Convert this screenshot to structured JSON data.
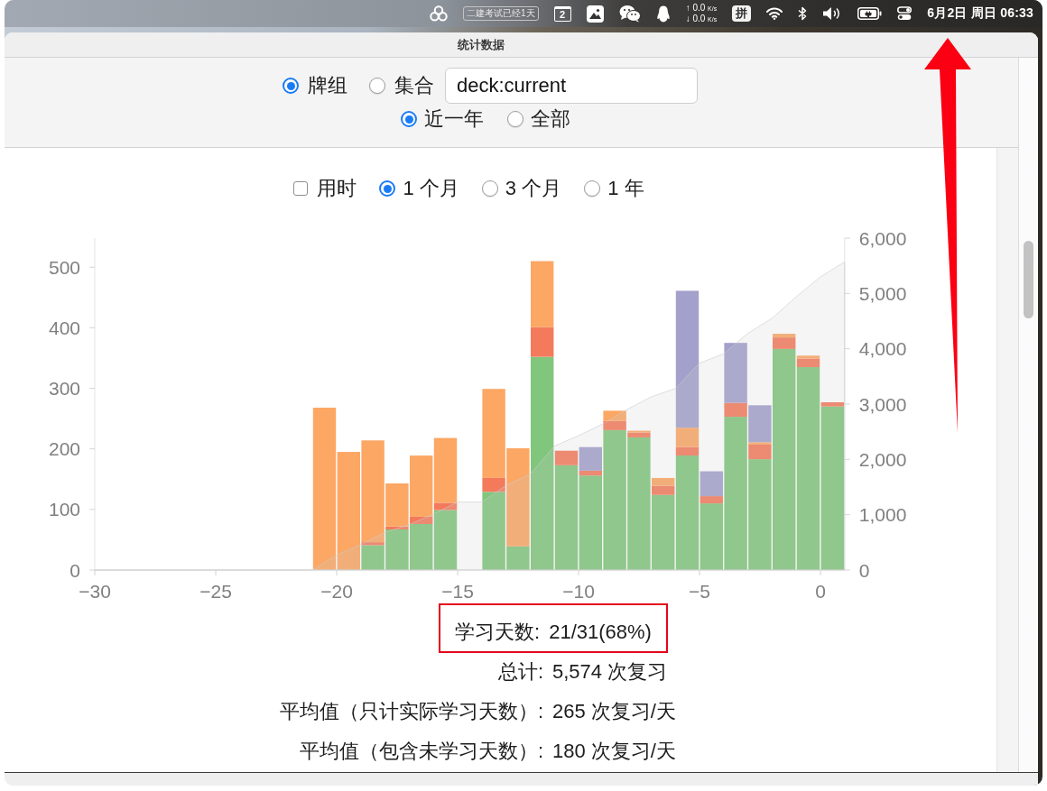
{
  "menu_bar": {
    "badge": "二建考试已经1天",
    "calendar_day": "2",
    "net_speed": [
      {
        "arrow": "↑",
        "value": "0.0",
        "unit": "K/s"
      },
      {
        "arrow": "↓",
        "value": "0.0",
        "unit": "K/s"
      }
    ],
    "input_method": "拼",
    "clock": "6月2日 周日 06:33"
  },
  "window": {
    "title": "统计数据"
  },
  "search_scope": [
    {
      "label": "牌组",
      "selected": true
    },
    {
      "label": "集合",
      "selected": false
    }
  ],
  "search": {
    "value": "deck:current"
  },
  "range": [
    {
      "label": "近一年",
      "selected": true
    },
    {
      "label": "全部",
      "selected": false
    }
  ],
  "graph_options": {
    "checkbox": {
      "label": "用时",
      "checked": false
    },
    "periods": [
      {
        "label": "1 个月",
        "selected": true
      },
      {
        "label": "3 个月",
        "selected": false
      },
      {
        "label": "1 年",
        "selected": false
      }
    ]
  },
  "chart_data": {
    "type": "bar",
    "stacked": true,
    "x": [
      -20.5,
      -19.5,
      -18.5,
      -17.5,
      -16.5,
      -15.5,
      -14.5,
      -13.5,
      -12.5,
      -11.5,
      -10.5,
      -9.5,
      -8.5,
      -7.5,
      -6.5,
      -5.5,
      -4.5,
      -3.5,
      -2.5,
      -1.5,
      -0.5,
      0.5
    ],
    "xlim": [
      -30,
      1
    ],
    "ylim": [
      0,
      548
    ],
    "y2lim": [
      0,
      6000
    ],
    "xticks": [
      {
        "value": -30,
        "label": "−30"
      },
      {
        "value": -25,
        "label": "−25"
      },
      {
        "value": -20,
        "label": "−20"
      },
      {
        "value": -15,
        "label": "−15"
      },
      {
        "value": -10,
        "label": "−10"
      },
      {
        "value": -5,
        "label": "−5"
      },
      {
        "value": 0,
        "label": "0"
      }
    ],
    "yticks": [
      0,
      100,
      200,
      300,
      400,
      500
    ],
    "y2ticks": [
      {
        "value": 0,
        "label": "0"
      },
      {
        "value": 1000,
        "label": "1,000"
      },
      {
        "value": 2000,
        "label": "2,000"
      },
      {
        "value": 3000,
        "label": "3,000"
      },
      {
        "value": 4000,
        "label": "4,000"
      },
      {
        "value": 5000,
        "label": "5,000"
      },
      {
        "value": 6000,
        "label": "6,000"
      }
    ],
    "series": [
      {
        "color": "#80c67c",
        "values": [
          0,
          0,
          41,
          67,
          76,
          99,
          null,
          129,
          39,
          352,
          173,
          156,
          231,
          219,
          124,
          189,
          110,
          253,
          183,
          365,
          335,
          270
        ]
      },
      {
        "color": "#f47a5c",
        "values": [
          0,
          0,
          5,
          5,
          12,
          12,
          null,
          23,
          0,
          49,
          24,
          8,
          15,
          8,
          15,
          14,
          12,
          23,
          24,
          19,
          14,
          7
        ]
      },
      {
        "color": "#fca764",
        "values": [
          268,
          195,
          168,
          71,
          101,
          107,
          null,
          147,
          162,
          109,
          0,
          0,
          17,
          3,
          13,
          32,
          0,
          0,
          4,
          6,
          5,
          0
        ]
      },
      {
        "color": "#a3a0cc",
        "values": [
          0,
          0,
          0,
          0,
          0,
          0,
          null,
          0,
          0,
          0,
          0,
          39,
          0,
          0,
          0,
          226,
          41,
          99,
          61,
          0,
          0,
          0
        ]
      },
      {
        "type": "area",
        "axis": "y2",
        "color": "#cccccc",
        "x": [
          -30,
          -21,
          -20,
          -19,
          -18,
          -17,
          -16,
          -15,
          -14,
          -13,
          -12,
          -11,
          -10,
          -9,
          -8,
          -7,
          -6,
          -5,
          -4,
          -3,
          -2,
          -1,
          0,
          1
        ],
        "values": [
          0,
          0,
          270,
          460,
          680,
          820,
          1010,
          1230,
          1230,
          1530,
          1730,
          2240,
          2430,
          2640,
          2900,
          3130,
          3280,
          3740,
          3910,
          4280,
          4550,
          4940,
          5300,
          5570
        ]
      }
    ]
  },
  "summary": [
    {
      "label": "学习天数:",
      "value": "21/31(68%)",
      "highlighted": true
    },
    {
      "label": "总计:",
      "value": "5,574 次复习",
      "highlighted": false
    },
    {
      "label": "平均值（只计实际学习天数）:",
      "value": "265 次复习/天",
      "highlighted": false
    },
    {
      "label": "平均值（包含未学习天数）:",
      "value": "180 次复习/天",
      "highlighted": false
    }
  ],
  "annotations": [
    {
      "kind": "arrow"
    }
  ]
}
